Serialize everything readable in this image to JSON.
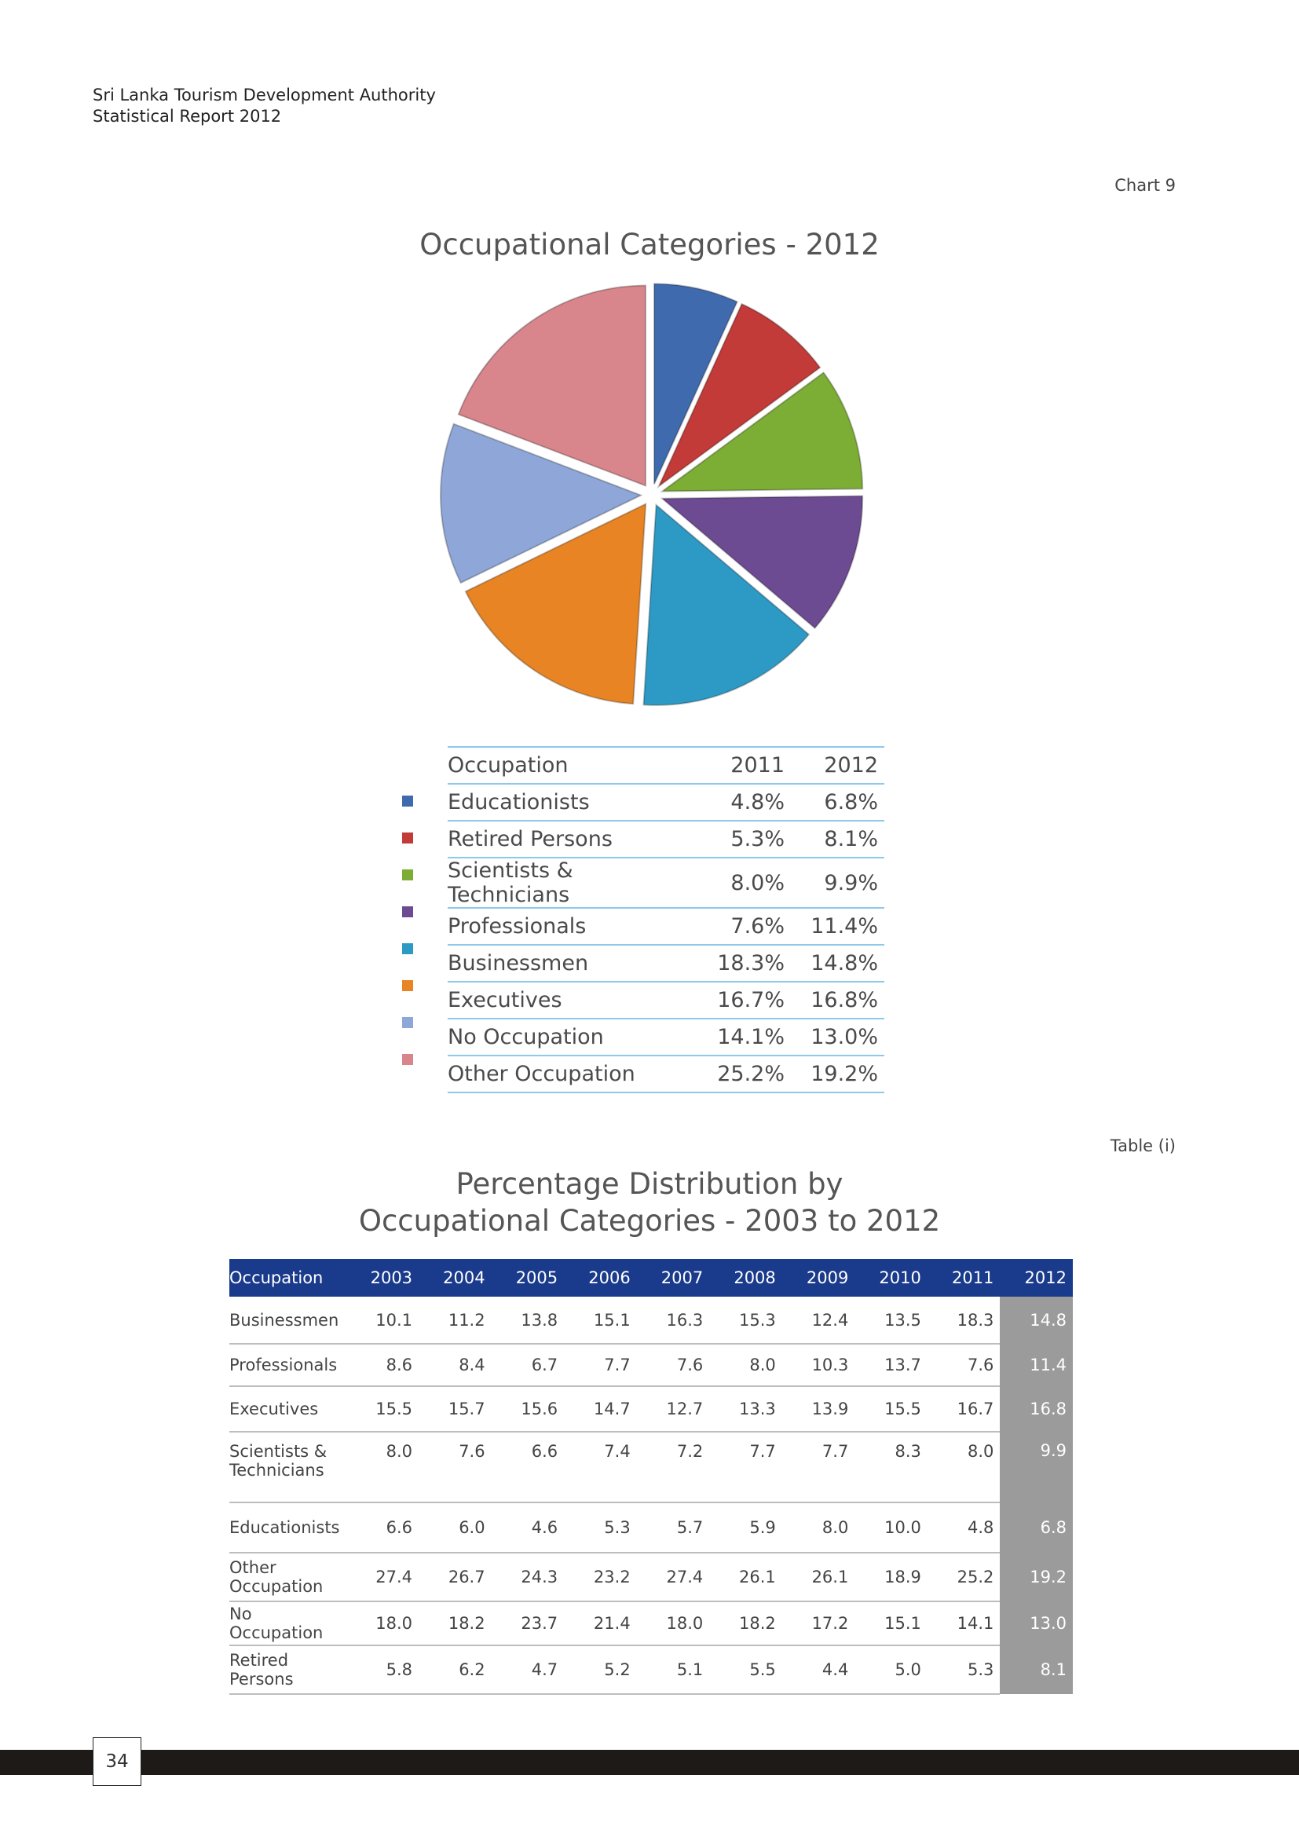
{
  "header": {
    "org": "Sri Lanka Tourism Development Authority",
    "report": "Statistical Report 2012"
  },
  "chart_label": "Chart 9",
  "chart_data": {
    "type": "pie",
    "title": "Occupational Categories - 2012",
    "categories": [
      "Educationists",
      "Retired Persons",
      "Scientists & Technicians",
      "Professionals",
      "Businessmen",
      "Executives",
      "No Occupation",
      "Other Occupation"
    ],
    "values": [
      6.8,
      8.1,
      9.9,
      11.4,
      14.8,
      16.8,
      13.0,
      19.2
    ],
    "colors": [
      "#3f6aad",
      "#c23b38",
      "#7cad34",
      "#6c4b93",
      "#2d9ac6",
      "#e88424",
      "#8ea7d8",
      "#d9858c"
    ]
  },
  "legend_table": {
    "headers": [
      "Occupation",
      "2011",
      "2012"
    ],
    "rows": [
      {
        "name": "Educationists",
        "v2011": "4.8%",
        "v2012": "6.8%",
        "color": "#3f6aad"
      },
      {
        "name": "Retired Persons",
        "v2011": "5.3%",
        "v2012": "8.1%",
        "color": "#c23b38"
      },
      {
        "name": "Scientists & Technicians",
        "v2011": "8.0%",
        "v2012": "9.9%",
        "color": "#7cad34"
      },
      {
        "name": "Professionals",
        "v2011": "7.6%",
        "v2012": "11.4%",
        "color": "#6c4b93"
      },
      {
        "name": "Businessmen",
        "v2011": "18.3%",
        "v2012": "14.8%",
        "color": "#2d9ac6"
      },
      {
        "name": "Executives",
        "v2011": "16.7%",
        "v2012": "16.8%",
        "color": "#e88424"
      },
      {
        "name": "No Occupation",
        "v2011": "14.1%",
        "v2012": "13.0%",
        "color": "#8ea7d8"
      },
      {
        "name": "Other Occupation",
        "v2011": "25.2%",
        "v2012": "19.2%",
        "color": "#d9858c"
      }
    ]
  },
  "table_label": "Table (i)",
  "table_title": {
    "line1": "Percentage Distribution by",
    "line2": "Occupational Categories - 2003 to 2012"
  },
  "data_table": {
    "headers": [
      "Occupation",
      "2003",
      "2004",
      "2005",
      "2006",
      "2007",
      "2008",
      "2009",
      "2010",
      "2011",
      "2012"
    ],
    "rows": [
      {
        "name": "Businessmen",
        "values": [
          "10.1",
          "11.2",
          "13.8",
          "15.1",
          "16.3",
          "15.3",
          "12.4",
          "13.5",
          "18.3",
          "14.8"
        ]
      },
      {
        "name": "Professionals",
        "values": [
          "8.6",
          "8.4",
          "6.7",
          "7.7",
          "7.6",
          "8.0",
          "10.3",
          "13.7",
          "7.6",
          "11.4"
        ]
      },
      {
        "name": "Executives",
        "values": [
          "15.5",
          "15.7",
          "15.6",
          "14.7",
          "12.7",
          "13.3",
          "13.9",
          "15.5",
          "16.7",
          "16.8"
        ]
      },
      {
        "name": "Scientists & Technicians",
        "values": [
          "8.0",
          "7.6",
          "6.6",
          "7.4",
          "7.2",
          "7.7",
          "7.7",
          "8.3",
          "8.0",
          "9.9"
        ]
      },
      {
        "name": "Educationists",
        "values": [
          "6.6",
          "6.0",
          "4.6",
          "5.3",
          "5.7",
          "5.9",
          "8.0",
          "10.0",
          "4.8",
          "6.8"
        ]
      },
      {
        "name": "Other Occupation",
        "values": [
          "27.4",
          "26.7",
          "24.3",
          "23.2",
          "27.4",
          "26.1",
          "26.1",
          "18.9",
          "25.2",
          "19.2"
        ]
      },
      {
        "name": "No Occupation",
        "values": [
          "18.0",
          "18.2",
          "23.7",
          "21.4",
          "18.0",
          "18.2",
          "17.2",
          "15.1",
          "14.1",
          "13.0"
        ]
      },
      {
        "name": "Retired Persons",
        "values": [
          "5.8",
          "6.2",
          "4.7",
          "5.2",
          "5.1",
          "5.5",
          "4.4",
          "5.0",
          "5.3",
          "8.1"
        ]
      }
    ]
  },
  "page_number": "34"
}
